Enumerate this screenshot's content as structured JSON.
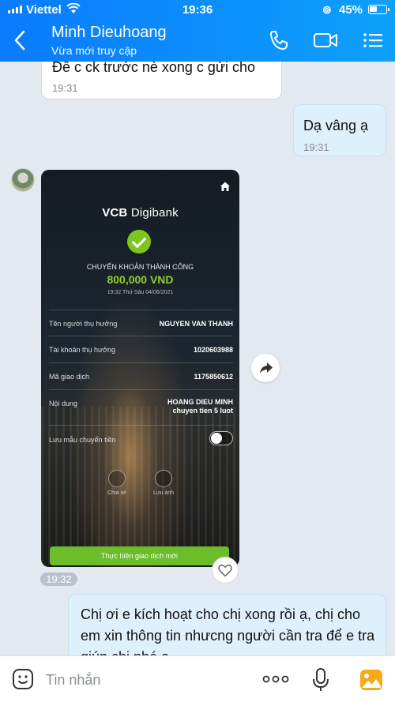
{
  "status_bar": {
    "carrier": "Viettel",
    "time": "19:36",
    "battery": "45%",
    "battery_level": 0.45
  },
  "header": {
    "contact_name": "Minh Dieuhoang",
    "contact_status": "Vừa mới truy cập"
  },
  "messages": [
    {
      "side": "left",
      "text": "Đề c ck trước nè xong c gửi cho",
      "time": "19:31"
    },
    {
      "side": "right",
      "text": "Dạ vâng ạ",
      "time": "19:31"
    },
    {
      "side": "left",
      "type": "image",
      "time": "19:32"
    },
    {
      "side": "right",
      "text": "Chị ơi e kích hoạt cho chị xong rồi ạ, chị cho em xin thông tin nhưcng người cần tra để e tra giúp chị nhé ạ"
    }
  ],
  "receipt": {
    "brand": "VCB",
    "brand_suffix": "Digibank",
    "status_title": "CHUYỂN KHOẢN THÀNH CÔNG",
    "amount": "800,000 VND",
    "datetime": "19:32 Thứ Sáu 04/06/2021",
    "rows": [
      {
        "label": "Tên người thụ hưởng",
        "value": "NGUYEN VAN THANH"
      },
      {
        "label": "Tài khoản thụ hưởng",
        "value": "1020603988"
      },
      {
        "label": "Mã giao dịch",
        "value": "1175850612"
      },
      {
        "label": "Nội dung",
        "value_line1": "HOANG DIEU MINH",
        "value_line2": "chuyen tien 5 luot"
      }
    ],
    "save_template_label": "Lưu mẫu chuyển tiền",
    "share_label": "Chia sẻ",
    "save_label": "Lưu ảnh",
    "new_transaction_button": "Thực hiện giao dịch mới"
  },
  "input": {
    "placeholder": "Tin nhắn"
  },
  "colors": {
    "header_gradient_start": "#0a7bfd",
    "header_gradient_end": "#0ea0fb",
    "bubble_right": "#dff0fd",
    "success_green": "#7ec61f"
  }
}
